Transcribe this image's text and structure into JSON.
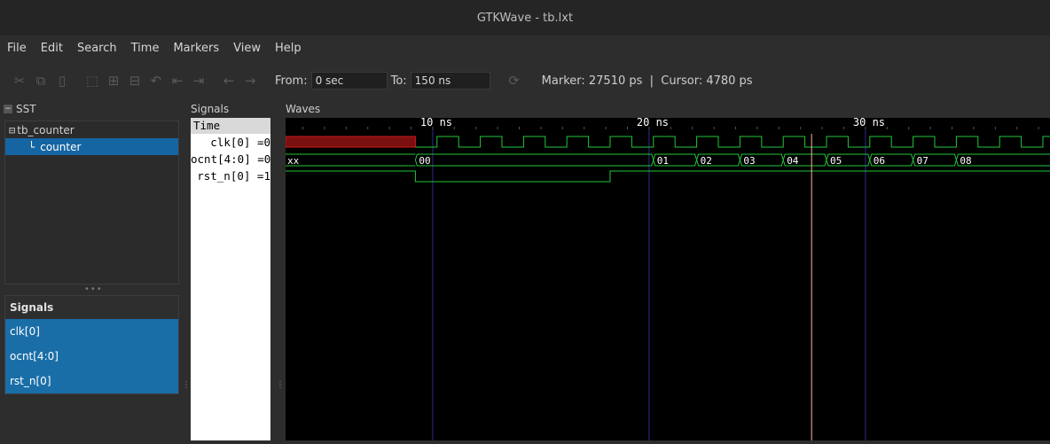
{
  "window": {
    "title": "GTKWave - tb.lxt"
  },
  "menu": [
    "File",
    "Edit",
    "Search",
    "Time",
    "Markers",
    "View",
    "Help"
  ],
  "toolbar": {
    "icons": [
      "cut-icon",
      "copy-icon",
      "paste-icon",
      "zoom-fit-icon",
      "zoom-in-icon",
      "zoom-out-icon",
      "undo-icon",
      "zoom-left-icon",
      "zoom-right-icon",
      "prev-edge-icon",
      "next-edge-icon"
    ],
    "from_label": "From:",
    "from_value": "0 sec",
    "to_label": "To:",
    "to_value": "150 ns",
    "reload_icon": "reload-icon",
    "marker_text": "Marker: 27510 ps  |  Cursor: 4780 ps"
  },
  "sst": {
    "header": "SST",
    "tree": {
      "root": "tb_counter",
      "child": "counter"
    },
    "signals_title": "Signals",
    "signals": [
      "clk[0]",
      "ocnt[4:0]",
      "rst_n[0]"
    ]
  },
  "signals_pane": {
    "header": "Signals",
    "time_label": "Time",
    "rows": [
      "clk[0] =0",
      "ocnt[4:0] =0",
      "rst_n[0] =1"
    ]
  },
  "waves": {
    "header": "Waves",
    "colors": {
      "green": "#22c63a",
      "red": "#d11a1a",
      "red_fill": "#7a0f0f",
      "grid": "#2c2c8a",
      "cursor": "#ffb0a0",
      "text": "#ffffff"
    },
    "time_scale": {
      "unit": "ns",
      "ticks": [
        10,
        20,
        30
      ]
    },
    "cursor_ps": 27510,
    "clk": {
      "unknown_until_ns": 9.2,
      "first_rise_ns": 10.2,
      "period_ns": 2.0
    },
    "ocnt": {
      "unknown_label": "xx",
      "segments": [
        {
          "start_ns": 9.2,
          "value": "00"
        },
        {
          "start_ns": 20.2,
          "value": "01"
        },
        {
          "start_ns": 22.2,
          "value": "02"
        },
        {
          "start_ns": 24.2,
          "value": "03"
        },
        {
          "start_ns": 26.2,
          "value": "04"
        },
        {
          "start_ns": 28.2,
          "value": "05"
        },
        {
          "start_ns": 30.2,
          "value": "06"
        },
        {
          "start_ns": 32.2,
          "value": "07"
        },
        {
          "start_ns": 34.2,
          "value": "08"
        }
      ]
    },
    "rst_n": {
      "unknown_until_ns": 3.2,
      "low_from_ns": 9.2,
      "high_from_ns": 18.2
    }
  }
}
